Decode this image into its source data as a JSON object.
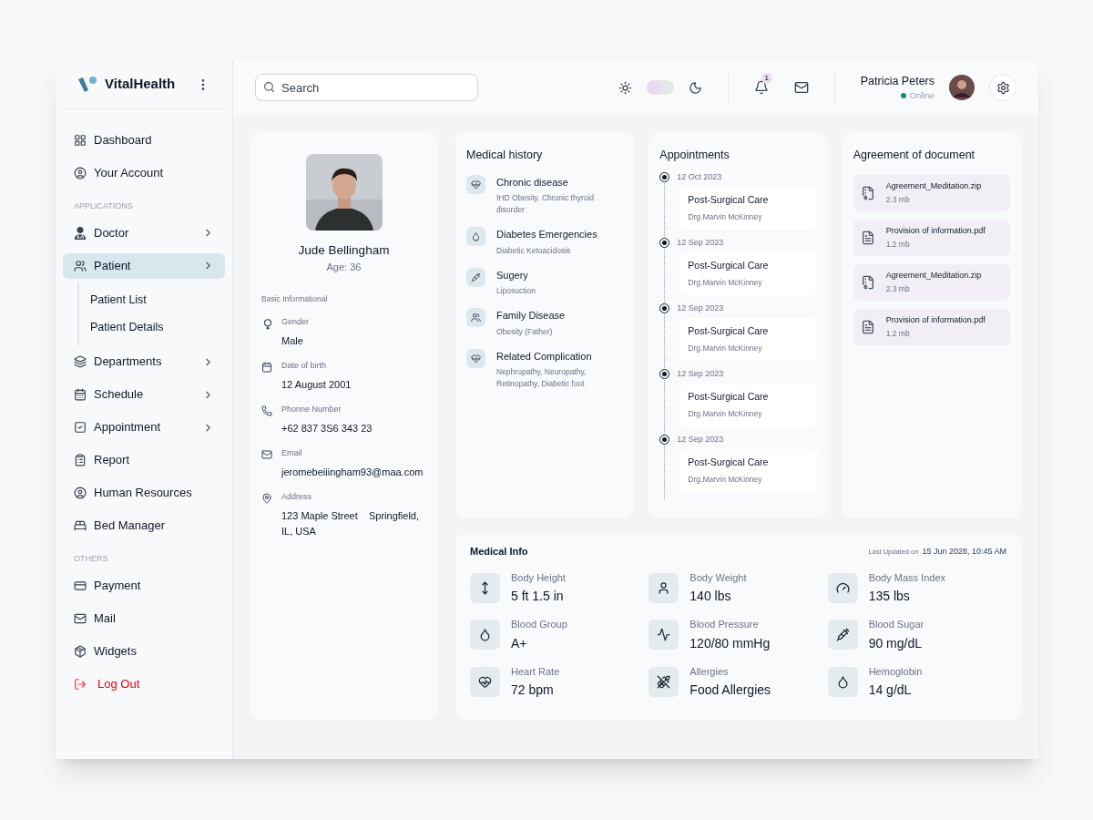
{
  "brand": {
    "name": "VitalHealth"
  },
  "sidebar": {
    "groups": [
      {
        "items": [
          {
            "label": "Dashboard",
            "selected": false
          },
          {
            "label": "Your Account",
            "selected": false
          }
        ]
      },
      {
        "title": "APPLICATIONS",
        "items": [
          {
            "label": "Doctor",
            "selected": false,
            "expandable": true
          },
          {
            "label": "Patient",
            "selected": true,
            "expandable": true,
            "children": [
              {
                "label": "Patient List",
                "selected": false
              },
              {
                "label": "Patient Details",
                "selected": false
              }
            ]
          },
          {
            "label": "Departments",
            "selected": false,
            "expandable": true
          },
          {
            "label": "Schedule",
            "selected": false,
            "expandable": true
          },
          {
            "label": "Appointment",
            "selected": false,
            "expandable": true
          },
          {
            "label": "Report",
            "selected": false
          },
          {
            "label": "Human Resources",
            "selected": false
          },
          {
            "label": "Bed Manager",
            "selected": false
          }
        ]
      },
      {
        "title": "OTHERS",
        "items": [
          {
            "label": "Payment",
            "selected": false
          },
          {
            "label": "Mail",
            "selected": false
          },
          {
            "label": "Widgets",
            "selected": false
          },
          {
            "label": "Log Out",
            "selected": false,
            "kind": "danger"
          }
        ]
      }
    ]
  },
  "topbar": {
    "search": {
      "placeholder": "Search"
    },
    "dark_mode": false,
    "notifications": "1",
    "user": {
      "name": "Patricia Peters",
      "status": "Online",
      "online": true
    }
  },
  "patient": {
    "name": "Jude Bellingham",
    "age": "Age: 36",
    "section": "Basic Informational",
    "fields": [
      {
        "label": "Gender",
        "value": "Male"
      },
      {
        "label": "Date of birth",
        "value": "12 August 2001"
      },
      {
        "label": "Phonne Number",
        "value": "+62 837 3S6 343 23"
      },
      {
        "label": "Email",
        "value": "jeromebeiiingham93@maa.com"
      },
      {
        "label": "Address",
        "value": "123 Maple Street    Springfield, IL, USA"
      }
    ]
  },
  "medical_history": {
    "title": "Medical history",
    "items": [
      {
        "title": "Chronic disease",
        "detail": "IHD Obesity. Chronic thyroid disorder"
      },
      {
        "title": "Diabetes Emergencies",
        "detail": "Diabetic Ketoacidosis"
      },
      {
        "title": "Sugery",
        "detail": "Liposuction"
      },
      {
        "title": "Family Disease",
        "detail": "Obesity (Father)"
      },
      {
        "title": "Related Complication",
        "detail": "Nephropathy, Neuropathy, Retinopathy, Diabetic foot"
      }
    ]
  },
  "appointments": {
    "title": "Appointments",
    "items": [
      {
        "date": "12 Oct 2023",
        "title": "Post-Surgical Care",
        "doctor": "Drg.Marvin McKinney"
      },
      {
        "date": "12 Sep 2023",
        "title": "Post-Surgical Care",
        "doctor": "Drg.Marvin McKinney"
      },
      {
        "date": "12 Sep 2023",
        "title": "Post-Surgical Care",
        "doctor": "Drg.Marvin McKinney"
      },
      {
        "date": "12 Sep 2023",
        "title": "Post-Surgical Care",
        "doctor": "Drg.Marvin McKinney"
      },
      {
        "date": "12 Sep 2023",
        "title": "Post-Surgical Care",
        "doctor": "Drg.Marvin McKinney"
      }
    ]
  },
  "documents": {
    "title": "Agreement of document",
    "items": [
      {
        "name": "Agreement_Meditation.zip",
        "size": "2.3 mb",
        "kind": "zip"
      },
      {
        "name": "Provision of information.pdf",
        "size": "1.2 mb",
        "kind": "pdf"
      },
      {
        "name": "Agreement_Meditation.zip",
        "size": "2.3 mb",
        "kind": "zip"
      },
      {
        "name": "Provision of information.pdf",
        "size": "1.2 mb",
        "kind": "pdf"
      }
    ]
  },
  "medical_info": {
    "title": "Medical Info",
    "updated_label": "Last Updated on",
    "updated_value": "15 Jun 2028, 10:45 AM",
    "metrics": [
      {
        "label": "Body Height",
        "value": "5 ft 1.5 in"
      },
      {
        "label": "Body Weight",
        "value": "140 lbs"
      },
      {
        "label": "Body Mass Index",
        "value": "135 lbs"
      },
      {
        "label": "Blood Group",
        "value": "A+"
      },
      {
        "label": "Blood Pressure",
        "value": "120/80 mmHg"
      },
      {
        "label": "Blood Sugar",
        "value": "90 mg/dL"
      },
      {
        "label": "Heart Rate",
        "value": "72 bpm"
      },
      {
        "label": "Allergies",
        "value": "Food Allergies"
      },
      {
        "label": "Hemoglobin",
        "value": "14 g/dL"
      }
    ]
  }
}
